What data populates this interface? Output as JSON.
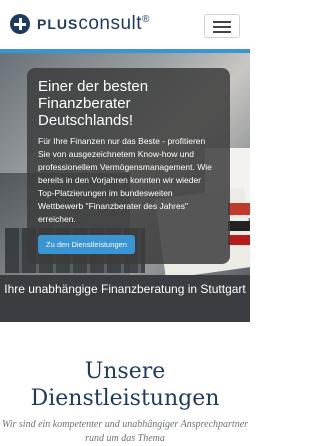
{
  "header": {
    "brand_prefix": "PLUS",
    "brand_suffix": "consult",
    "brand_mark": "®",
    "logo_icon": "plus-circle-icon",
    "menu_icon": "hamburger-menu-icon"
  },
  "hero": {
    "title": "Einer der besten Finanzberater Deutschlands!",
    "text": "Für Ihre Finanzen nur das Beste - profitieren Sie von ausgezeichnetem Know-how und professionellem Vermögensmanagement. Wie bereits in den Vorjahren konnten wir wieder Top-Platzierungen im bundesweiten Wettbewerb \"Finanzberater des Jahres\" erreichen.",
    "button_label": "Zu den Dienstleistungen"
  },
  "band": {
    "text": "Ihre unabhängige Finanzberatung in Stuttgart"
  },
  "services": {
    "title": "Unsere Dienstleistungen",
    "subtitle": "Wir sind ein kompetenter und unabhängiger Ansprechpartner rund um das Thema"
  },
  "colors": {
    "accent": "#3a95d4",
    "brand": "#1e3a5f",
    "band": "#3a3d42"
  }
}
